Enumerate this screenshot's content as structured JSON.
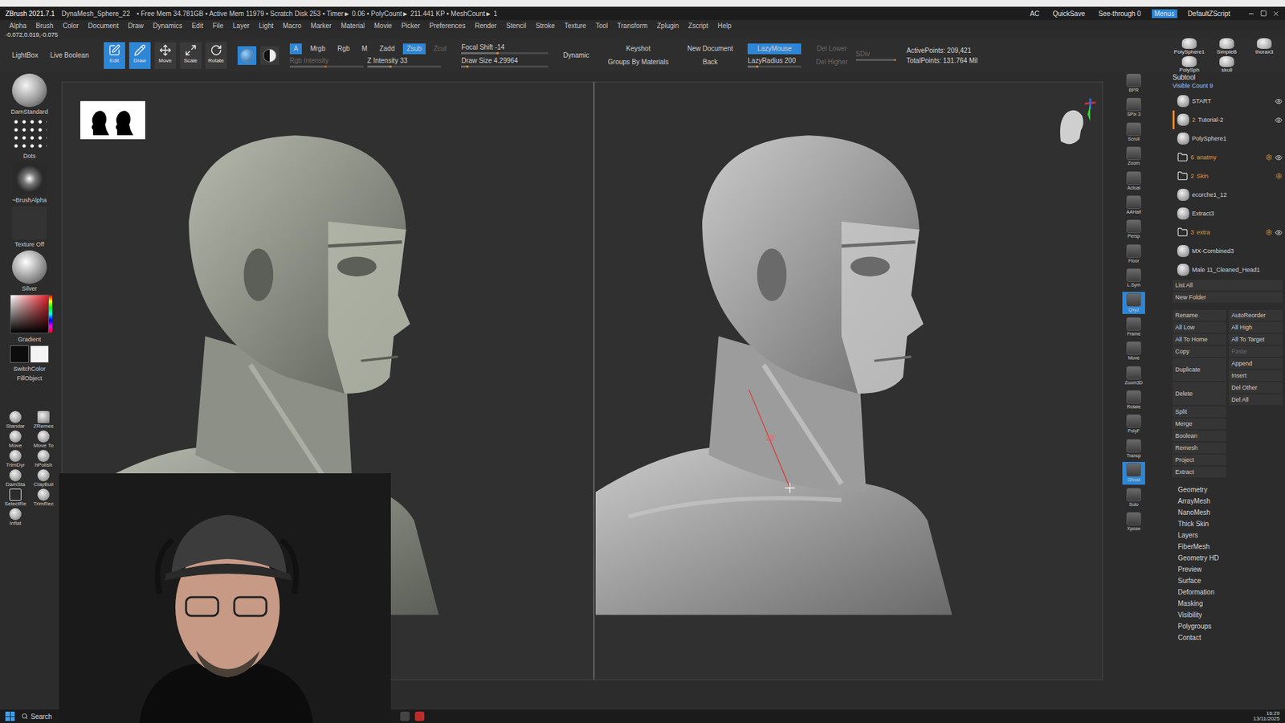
{
  "title_bar": {
    "app": "ZBrush 2021.7.1",
    "document": "DynaMesh_Sphere_22",
    "status": "• Free Mem 34.781GB • Active Mem 11979 • Scratch Disk 253 • Timer► 0.06 • PolyCount► 211.441 KP • MeshCount► 1",
    "right_items": [
      {
        "label": "AC",
        "selected": false
      },
      {
        "label": "QuickSave",
        "selected": false
      },
      {
        "label": "See-through 0",
        "selected": false
      },
      {
        "label": "Menus",
        "selected": true
      },
      {
        "label": "DefaultZScript",
        "selected": false
      }
    ]
  },
  "menu": [
    "Alpha",
    "Brush",
    "Color",
    "Document",
    "Draw",
    "Dynamics",
    "Edit",
    "File",
    "Layer",
    "Light",
    "Macro",
    "Marker",
    "Material",
    "Movie",
    "Picker",
    "Preferences",
    "Render",
    "Stencil",
    "Stroke",
    "Texture",
    "Tool",
    "Transform",
    "Zplugin",
    "Zscript",
    "Help"
  ],
  "coordinates": "-0.072,0.019,-0.075",
  "shelf": {
    "toggles": [
      {
        "label": "LightBox"
      },
      {
        "label": "Live Boolean"
      }
    ],
    "transform": [
      {
        "label": "Edit",
        "selected": true
      },
      {
        "label": "Draw",
        "selected": true
      },
      {
        "label": "Move",
        "selected": false
      },
      {
        "label": "Scale",
        "selected": false
      },
      {
        "label": "Rotate",
        "selected": false
      }
    ],
    "mode_icons": [
      {
        "selected": true
      },
      {
        "selected": false
      }
    ],
    "channels": [
      {
        "label": "A",
        "selected": true,
        "disabled": false
      },
      {
        "label": "Mrgb",
        "selected": false,
        "disabled": false
      },
      {
        "label": "Rgb",
        "selected": false,
        "disabled": false
      },
      {
        "label": "M",
        "selected": false,
        "disabled": false
      },
      {
        "label": "Zadd",
        "selected": false,
        "disabled": false
      },
      {
        "label": "Zsub",
        "selected": true,
        "disabled": false
      },
      {
        "label": "Zcut",
        "selected": false,
        "disabled": true
      }
    ],
    "intensity_sliders": [
      {
        "label": "Rgb Intensity",
        "level": 0.5,
        "disabled": true
      },
      {
        "label": "Z Intensity 33",
        "level": 0.33,
        "disabled": false
      }
    ],
    "brush_sliders": [
      {
        "label": "Focal Shift -14",
        "level": 0.43,
        "disabled": false
      },
      {
        "label": "Draw Size 4.29964",
        "level": 0.08,
        "disabled": false
      }
    ],
    "dynamic": {
      "label": "Dynamic",
      "selected": false
    },
    "render_buttons": [
      {
        "label": "Keyshot"
      },
      {
        "label": "Groups By Materials"
      }
    ],
    "document_buttons": [
      {
        "label": "New Document"
      },
      {
        "label": "Back"
      }
    ],
    "lazy": {
      "button": {
        "label": "LazyMouse",
        "selected": true
      },
      "slider": {
        "label": "LazyRadius 200",
        "level": 0.2,
        "disabled": false
      }
    },
    "subdiv": {
      "buttons": [
        {
          "label": "Del Lower",
          "disabled": true
        },
        {
          "label": "Del Higher",
          "disabled": true
        }
      ],
      "slider": {
        "label": "SDiv",
        "level": 1,
        "disabled": true
      }
    },
    "stats": [
      "ActivePoints: 209,421",
      "TotalPoints: 131.764 Mil"
    ],
    "tool_thumbnails": [
      {
        "label": "PolySphere1"
      },
      {
        "label": "SimpleB"
      },
      {
        "label": "thorax3"
      },
      {
        "label": "PolySph"
      },
      {
        "label": "skull"
      }
    ]
  },
  "left_shelf": {
    "items": [
      {
        "label": "DamStandard",
        "kind": "brush"
      },
      {
        "label": "Dots",
        "kind": "stroke"
      },
      {
        "label": "~BrushAlpha",
        "kind": "alpha"
      },
      {
        "label": "Texture Off",
        "kind": "texture"
      },
      {
        "label": "Silver",
        "kind": "material"
      }
    ],
    "gradient": "Gradient",
    "switch_color": "SwitchColor",
    "fill_object": "FillObject",
    "brushes": [
      {
        "label": "Standar",
        "kind": "sphere"
      },
      {
        "label": "ZRemes",
        "kind": "cube"
      },
      {
        "label": "Move",
        "kind": "sphere"
      },
      {
        "label": "Move To",
        "kind": "sphere"
      },
      {
        "label": "TrimDyr",
        "kind": "sphere"
      },
      {
        "label": "hPolish",
        "kind": "sphere"
      },
      {
        "label": "DamSta",
        "kind": "sphere"
      },
      {
        "label": "ClayBuil",
        "kind": "sphere"
      },
      {
        "label": "SelectRe",
        "kind": "select"
      },
      {
        "label": "TrimRec",
        "kind": "sphere"
      },
      {
        "label": "Inflat",
        "kind": "sphere"
      }
    ]
  },
  "canvas": {
    "measure_label": "23"
  },
  "right_shelf": [
    {
      "label": "BPR",
      "selected": false
    },
    {
      "label": "SPix 3",
      "selected": false
    },
    {
      "label": "Scroll",
      "selected": false
    },
    {
      "label": "Zoom",
      "selected": false
    },
    {
      "label": "Actual",
      "selected": false
    },
    {
      "label": "AAHalf",
      "selected": false
    },
    {
      "label": "Persp",
      "selected": false
    },
    {
      "label": "Floor",
      "selected": false
    },
    {
      "label": "L.Sym",
      "selected": false
    },
    {
      "label": "Qxyz",
      "selected": true
    },
    {
      "label": "Frame",
      "selected": false
    },
    {
      "label": "Move",
      "selected": false
    },
    {
      "label": "Zoom3D",
      "selected": false
    },
    {
      "label": "Rotate",
      "selected": false
    },
    {
      "label": "PolyF",
      "selected": false
    },
    {
      "label": "Transp",
      "selected": false
    },
    {
      "label": "Ghost",
      "selected": true
    },
    {
      "label": "Solo",
      "selected": false
    },
    {
      "label": "Xpose",
      "selected": false
    }
  ],
  "tray": {
    "title": "Subtool",
    "visible_count": "Visible Count 9",
    "subtools": [
      {
        "kind": "subtool",
        "name": "START",
        "visible": true,
        "selected": false
      },
      {
        "kind": "subtool",
        "name": "Tutorial-2",
        "count": "2",
        "visible": true,
        "selected": true
      },
      {
        "kind": "subtool",
        "name": "PolySphere1",
        "visible": false,
        "selected": false
      },
      {
        "kind": "folder",
        "name": "anatmy",
        "count": "6",
        "visible": true,
        "selected": false
      },
      {
        "kind": "folder",
        "name": "Skin",
        "count": "2",
        "visible": false,
        "selected": false
      },
      {
        "kind": "subtool",
        "name": "ecorche1_12",
        "visible": false,
        "selected": false
      },
      {
        "kind": "subtool",
        "name": "Extract3",
        "visible": false,
        "selected": false
      },
      {
        "kind": "folder",
        "name": "extra",
        "count": "3",
        "visible": true,
        "selected": false
      },
      {
        "kind": "subtool",
        "name": "MX-Combined3",
        "visible": false,
        "selected": false
      },
      {
        "kind": "subtool",
        "name": "Male 11_Cleaned_Head1",
        "visible": false,
        "selected": false
      }
    ],
    "list_buttons": [
      "List All",
      "New Folder"
    ],
    "button_groups": [
      {
        "left": {
          "label": "Rename",
          "disabled": false
        },
        "right": [
          {
            "label": "AutoReorder",
            "disabled": false
          }
        ]
      },
      {
        "left": {
          "label": "All Low",
          "disabled": false
        },
        "right": [
          {
            "label": "All High",
            "disabled": false
          }
        ]
      },
      {
        "left": {
          "label": "All To Home",
          "disabled": false
        },
        "right": [
          {
            "label": "All To Target",
            "disabled": false
          }
        ]
      },
      {
        "left": {
          "label": "Copy",
          "disabled": false
        },
        "right": [
          {
            "label": "Paste",
            "disabled": true
          }
        ]
      },
      {
        "left": {
          "label": "Duplicate",
          "disabled": false
        },
        "right": [
          {
            "label": "Append",
            "disabled": false
          },
          {
            "label": "Insert",
            "disabled": false
          }
        ]
      },
      {
        "left": {
          "label": "Delete",
          "disabled": false
        },
        "right": [
          {
            "label": "Del Other",
            "disabled": false
          },
          {
            "label": "Del All",
            "disabled": false
          }
        ]
      },
      {
        "left": {
          "label": "Split",
          "disabled": false
        },
        "right": []
      },
      {
        "left": {
          "label": "Merge",
          "disabled": false
        },
        "right": []
      },
      {
        "left": {
          "label": "Boolean",
          "disabled": false
        },
        "right": []
      },
      {
        "left": {
          "label": "Remesh",
          "disabled": false
        },
        "right": []
      },
      {
        "left": {
          "label": "Project",
          "disabled": false
        },
        "right": []
      },
      {
        "left": {
          "label": "Extract",
          "disabled": false
        },
        "right": []
      }
    ],
    "sections": [
      "Geometry",
      "ArrayMesh",
      "NanoMesh",
      "Thick Skin",
      "Layers",
      "FiberMesh",
      "Geometry HD",
      "Preview",
      "Surface",
      "Deformation",
      "Masking",
      "Visibility",
      "Polygroups",
      "Contact"
    ]
  },
  "taskbar": {
    "search": "Search",
    "time": "16:29",
    "date": "13/11/2025"
  }
}
